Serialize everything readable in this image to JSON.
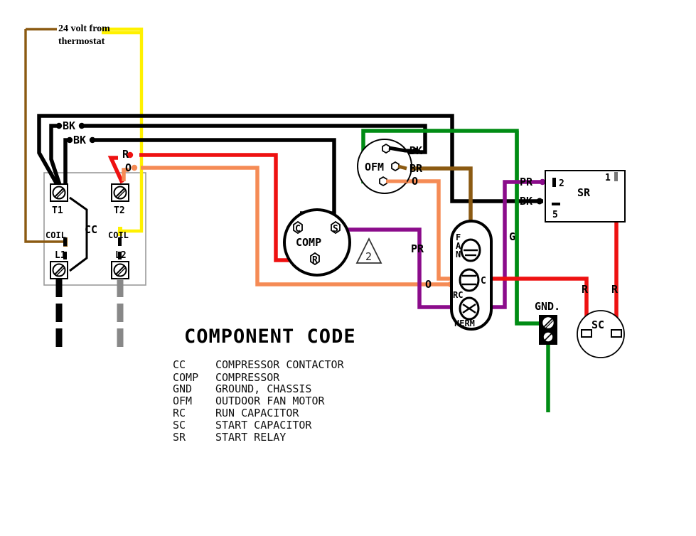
{
  "diagram": {
    "title_note": {
      "line1": "24 volt from",
      "line2": "thermostat"
    },
    "note_marker": "2",
    "colors": {
      "black": "#000000",
      "brown": "#8B5A12",
      "yellow": "#FFF100",
      "red": "#EE1111",
      "orange": "#F58B55",
      "green": "#008C14",
      "purple": "#8B0C8B",
      "gray": "#888888",
      "white": "#FFFFFF"
    },
    "components": {
      "cc": {
        "name": "CC",
        "terminals": {
          "t1": "T1",
          "t2": "T2",
          "l1": "L1",
          "l2": "L2"
        },
        "coil_left": "COIL",
        "coil_right": "COIL"
      },
      "comp": {
        "name": "COMP",
        "terminals": {
          "c": "C",
          "s": "S",
          "r": "R"
        }
      },
      "ofm": {
        "name": "OFM",
        "wires": {
          "bk": "BK",
          "br": "BR",
          "o": "O"
        }
      },
      "rc": {
        "name": "RC",
        "terminals": {
          "fan": "FAN",
          "c": "C",
          "herm": "HERM"
        }
      },
      "sr": {
        "name": "SR",
        "terminals": {
          "one": "1",
          "two": "2",
          "five": "5"
        }
      },
      "sc": {
        "name": "SC"
      },
      "gnd": {
        "name": "GND."
      }
    },
    "wire_labels": {
      "bk_upper": "BK",
      "bk_lower": "BK",
      "r_cc": "R",
      "o_cc": "O",
      "pr_comp": "PR",
      "o_rc": "O",
      "g_green": "G",
      "pr_sr": "PR",
      "bk_sr": "BK",
      "r_sc_left": "R",
      "r_sc_right": "R"
    },
    "legend": {
      "title": "COMPONENT CODE",
      "rows": [
        {
          "code": "CC",
          "desc": "COMPRESSOR CONTACTOR"
        },
        {
          "code": "COMP",
          "desc": "COMPRESSOR"
        },
        {
          "code": "GND",
          "desc": "GROUND, CHASSIS"
        },
        {
          "code": "OFM",
          "desc": "OUTDOOR FAN MOTOR"
        },
        {
          "code": "RC",
          "desc": "RUN CAPACITOR"
        },
        {
          "code": "SC",
          "desc": "START CAPACITOR"
        },
        {
          "code": "SR",
          "desc": "START RELAY"
        }
      ]
    }
  }
}
